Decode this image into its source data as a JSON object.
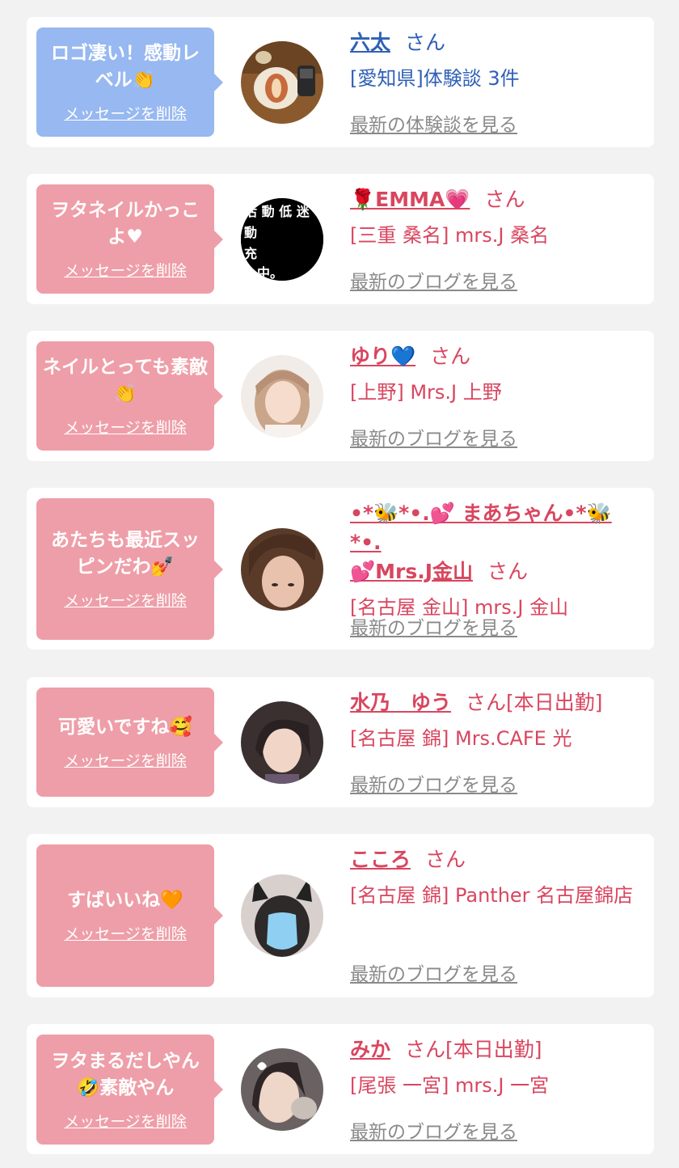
{
  "colors": {
    "background": "#f2f2f2",
    "card": "#ffffff",
    "bubble_blue": "#97b8f0",
    "bubble_pink": "#ee9ea8",
    "name_blue": "#2f60b6",
    "name_pink": "#d9465f",
    "link_gray": "#8a8a8a"
  },
  "items": [
    {
      "message": "ロゴ凄い！感動レベル👏",
      "delete_label": "メッセージを削除",
      "avatar_icon": "food-photo-avatar",
      "name": "六太",
      "honorific": "さん",
      "affiliation": "[愛知県]体験談 3件",
      "link": "最新の体験談を見る"
    },
    {
      "message": "ヲタネイルかっこよ♥",
      "delete_label": "メッセージを削除",
      "avatar_icon": "text-image-avatar",
      "avatar_text": "活動低迷 動 充 中。",
      "name": "🌹EMMA💗",
      "honorific": "さん",
      "affiliation": "[三重 桑名] mrs.J 桑名",
      "link": "最新のブログを見る"
    },
    {
      "message": "ネイルとっても素敵👏",
      "delete_label": "メッセージを削除",
      "avatar_icon": "person-photo-avatar",
      "name": "ゆり💙",
      "honorific": "さん",
      "affiliation": "[上野] Mrs.J 上野",
      "link": "最新のブログを見る"
    },
    {
      "message": "あたちも最近スッピンだわ💅",
      "delete_label": "メッセージを削除",
      "avatar_icon": "person-photo-avatar",
      "name_line1": "•*🐝*•.💕 まあちゃん•*🐝*•.",
      "name": "💕Mrs.J金山",
      "honorific": "さん",
      "affiliation": "[名古屋 金山] mrs.J 金山",
      "link": "最新のブログを見る"
    },
    {
      "message": "可愛いですね🥰",
      "delete_label": "メッセージを削除",
      "avatar_icon": "person-photo-avatar",
      "name": "水乃　ゆう",
      "honorific": "さん[本日出勤]",
      "affiliation": "[名古屋 錦] Mrs.CAFE 光",
      "link": "最新のブログを見る"
    },
    {
      "message": "すばいいね🧡",
      "delete_label": "メッセージを削除",
      "avatar_icon": "person-photo-avatar",
      "name": "こころ",
      "honorific": "さん",
      "affiliation": "[名古屋 錦] Panther 名古屋錦店",
      "link": "最新のブログを見る"
    },
    {
      "message": "ヲタまるだしやん🤣素敵やん",
      "delete_label": "メッセージを削除",
      "avatar_icon": "person-photo-avatar",
      "name": "みか",
      "honorific": "さん[本日出勤]",
      "affiliation": "[尾張 一宮] mrs.J 一宮",
      "link": "最新のブログを見る"
    }
  ]
}
